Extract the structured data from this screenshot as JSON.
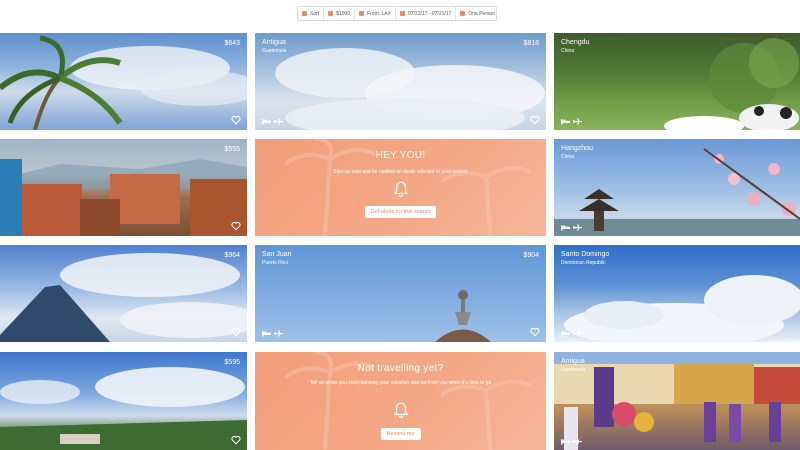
{
  "filters": [
    {
      "label": "Sort",
      "color": "#e58b65"
    },
    {
      "label": "$1000",
      "color": "#e58b65"
    },
    {
      "label": "From: LAX",
      "color": "#e58b65"
    },
    {
      "label": "07/22/17 - 07/21/17",
      "color": "#e58b65"
    },
    {
      "label": "One Person",
      "color": "#e58b65"
    }
  ],
  "cards": {
    "r1c1": {
      "price": "$643"
    },
    "r1c2": {
      "name": "Antigua",
      "country": "Guatemala",
      "price": "$818"
    },
    "r1c3": {
      "name": "Chengdu",
      "country": "China"
    },
    "r2c1": {
      "price": "$555"
    },
    "r2c3": {
      "name": "Hangzhou",
      "country": "China"
    },
    "r3c1": {
      "price": "$964"
    },
    "r3c2": {
      "name": "San Juan",
      "country": "Puerto Rico",
      "price": "$904"
    },
    "r3c3": {
      "name": "Santo Domingo",
      "country": "Dominican Republic"
    },
    "r4c1": {
      "price": "$595"
    },
    "r4c3": {
      "name": "Antigua",
      "country": "Guatemala"
    }
  },
  "promo1": {
    "title": "HEY YOU!",
    "text": "Sign up now and be notified on deals relevant to your search",
    "button": "Get alerts for this search"
  },
  "promo2": {
    "title": "Not travelling yet?",
    "text": "Tell us when you start planning your vacation and we'll tell you when it's time to go",
    "button": "Remind me"
  },
  "icons": {
    "heart": "heart-outline-icon",
    "bed": "bed-icon",
    "plane": "plane-icon",
    "bell": "bell-icon"
  }
}
